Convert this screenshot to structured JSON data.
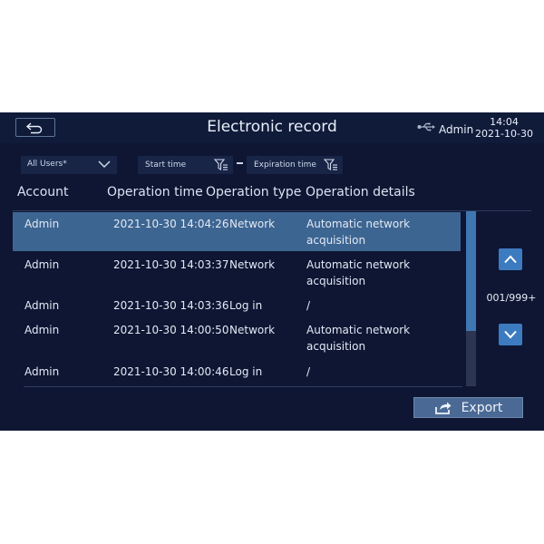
{
  "header": {
    "title": "Electronic record",
    "user": "Admin",
    "time": "14:04",
    "date": "2021-10-30"
  },
  "filters": {
    "user_select": "All Users*",
    "start_time": "Start time",
    "expiration_time": "Expiration time"
  },
  "columns": {
    "account": "Account",
    "operation_time": "Operation time",
    "operation_type": "Operation type",
    "operation_details": "Operation details"
  },
  "rows": [
    {
      "account": "Admin",
      "time": "2021-10-30  14:04:26",
      "type": "Network",
      "details": "Automatic network acquisition",
      "selected": true
    },
    {
      "account": "Admin",
      "time": "2021-10-30  14:03:37",
      "type": "Network",
      "details": "Automatic network acquisition",
      "selected": false
    },
    {
      "account": "Admin",
      "time": "2021-10-30  14:03:36",
      "type": "Log in",
      "details": "/",
      "selected": false
    },
    {
      "account": "Admin",
      "time": "2021-10-30  14:00:50",
      "type": "Network",
      "details": "Automatic network acquisition",
      "selected": false
    },
    {
      "account": "Admin",
      "time": "2021-10-30  14:00:46",
      "type": "Log in",
      "details": "/",
      "selected": false
    }
  ],
  "pagination": {
    "page_count": "001/999+"
  },
  "actions": {
    "export_label": "Export"
  },
  "icons": {
    "back": "back-arrow-icon",
    "usb": "usb-icon",
    "filter": "filter-icon",
    "up": "chevron-up-icon",
    "down": "chevron-down-icon",
    "export": "export-share-icon"
  }
}
